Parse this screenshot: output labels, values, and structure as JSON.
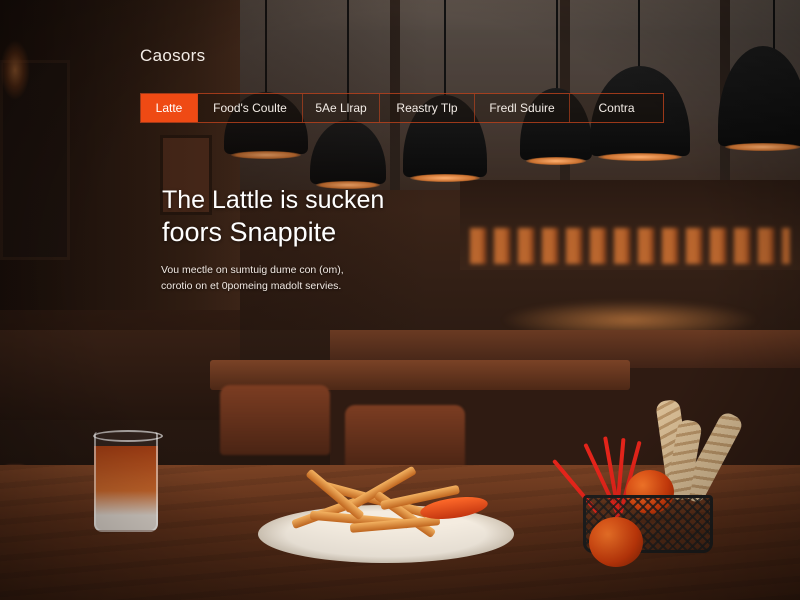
{
  "brand": {
    "logo_text": "Caosors"
  },
  "nav": {
    "items": [
      {
        "label": "Latte",
        "active": true
      },
      {
        "label": "Food's Coulte",
        "active": false
      },
      {
        "label": "5Ae Llrap",
        "active": false
      },
      {
        "label": "Reastry Tlp",
        "active": false
      },
      {
        "label": "Fredl Sduire",
        "active": false
      },
      {
        "label": "Contra",
        "active": false
      }
    ]
  },
  "hero": {
    "headline_line1": "The Lattle is sucken",
    "headline_line2": "foors Snappite",
    "body_line1": "Vou mectle on sumtuig dume con (om),",
    "body_line2": "corotio on et 0pomeing madolt servies."
  },
  "colors": {
    "accent": "#ef4a14",
    "nav_border": "#c8461e",
    "text": "#f3ece6"
  }
}
